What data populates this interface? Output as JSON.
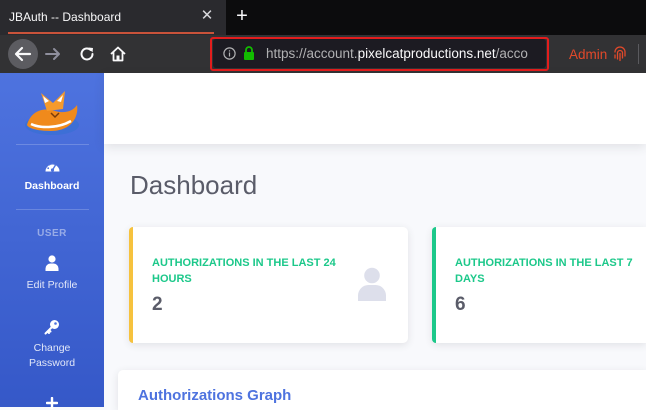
{
  "browser": {
    "tab_title": "JBAuth -- Dashboard",
    "tab_close": "✕",
    "new_tab": "+",
    "url_prefix": "https://account.",
    "url_domain": "pixelcatproductions.net",
    "url_suffix": "/acco",
    "account_label": "Admin"
  },
  "sidebar": {
    "items": [
      {
        "label": "Dashboard"
      },
      {
        "label": "Edit Profile"
      },
      {
        "label_line1": "Change",
        "label_line2": "Password"
      }
    ],
    "heading_user": "USER"
  },
  "main": {
    "page_title": "Dashboard",
    "cards": [
      {
        "label": "AUTHORIZATIONS IN THE LAST 24 HOURS",
        "value": "2",
        "accent": "#f6c23e",
        "icon": "user-icon"
      },
      {
        "label": "AUTHORIZATIONS IN THE LAST 7 DAYS",
        "value": "6",
        "accent": "#1cc88a"
      }
    ],
    "graph_title": "Authorizations Graph"
  },
  "colors": {
    "sidebar": "#4e73df",
    "label_green": "#1cc88a",
    "highlight": "#e21d1d"
  }
}
